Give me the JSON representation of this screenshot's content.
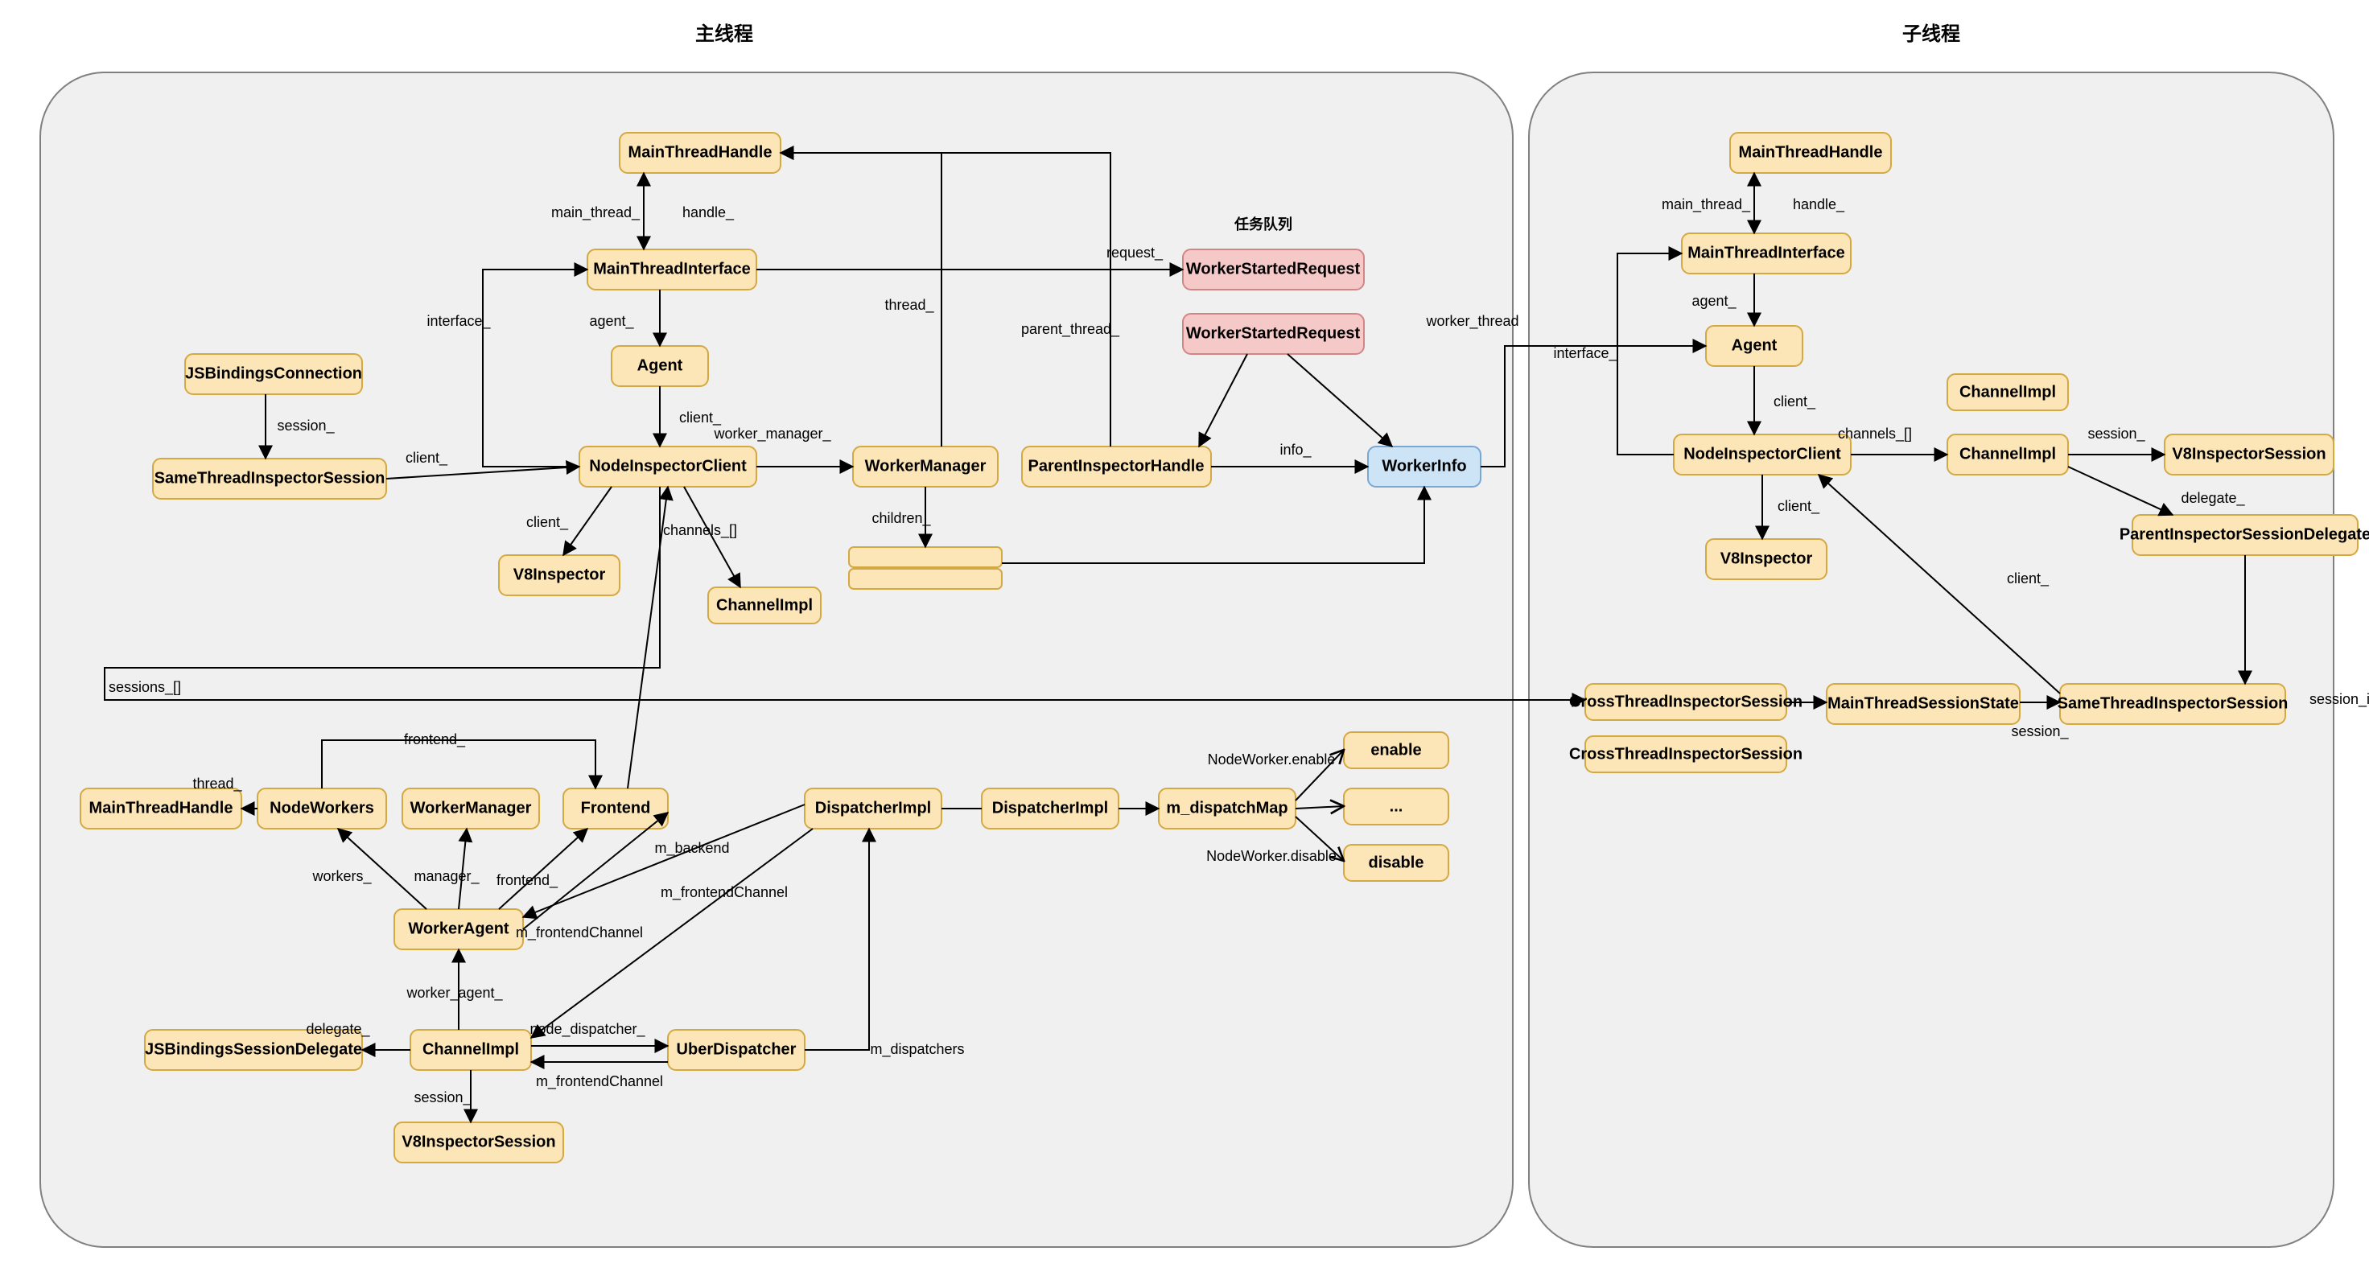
{
  "groups": {
    "left": {
      "title": "主线程"
    },
    "right": {
      "title": "子线程"
    }
  },
  "queueTitle": "任务队列",
  "nodes": {
    "mth_l": "MainThreadHandle",
    "mti_l": "MainThreadInterface",
    "agent_l": "Agent",
    "nic_l": "NodeInspectorClient",
    "v8i_l": "V8Inspector",
    "jsbc": "JSBindingsConnection",
    "stis": "SameThreadInspectorSession",
    "wm": "WorkerManager",
    "children": "",
    "ci_l": "ChannelImpl",
    "pih": "ParentInspectorHandle",
    "wsr1": "WorkerStartedRequest",
    "wsr2": "WorkerStartedRequest",
    "wi": "WorkerInfo",
    "mth_r": "MainThreadHandle",
    "mti_r": "MainThreadInterface",
    "agent_r": "Agent",
    "nic_r": "NodeInspectorClient",
    "v8i_r": "V8Inspector",
    "ci_r1": "ChannelImpl",
    "ci_r2": "ChannelImpl",
    "vis_r": "V8InspectorSession",
    "pisd": "ParentInspectorSessionDelegate",
    "ctis1": "CrossThreadInspectorSession",
    "ctis2": "CrossThreadInspectorSession",
    "mtss": "MainThreadSessionState",
    "stis_r": "SameThreadInspectorSession",
    "mth_b": "MainThreadHandle",
    "nw": "NodeWorkers",
    "wm_b": "WorkerManager",
    "fe": "Frontend",
    "wa": "WorkerAgent",
    "ci_b": "ChannelImpl",
    "jsbsd": "JSBindingsSessionDelegate",
    "vis_b": "V8InspectorSession",
    "ud": "UberDispatcher",
    "di1": "DispatcherImpl",
    "di2": "DispatcherImpl",
    "dm": "m_dispatchMap",
    "enable": "enable",
    "dots": "...",
    "disable": "disable"
  },
  "edges": {
    "main_thread": "main_thread_",
    "handle": "handle_",
    "agent": "agent_",
    "client": "client_",
    "interface": "interface_",
    "session": "session_",
    "worker_manager": "worker_manager_",
    "children": "children_",
    "channels": "channels_[]",
    "thread": "thread_",
    "request": "request_",
    "parent_thread": "parent_thread_",
    "worker_thread": "worker_thread",
    "info": "info_",
    "delegate": "delegate_",
    "session_id": "session_id",
    "sessions": "sessions_[]",
    "frontend": "frontend_",
    "workers": "workers_",
    "manager": "manager_",
    "worker_agent": "worker_agent_",
    "node_dispatcher": "node_dispatcher_",
    "m_dispatchers": "m_dispatchers",
    "m_backend": "m_backend",
    "m_frontendChannel": "m_frontendChannel",
    "nw_enable": "NodeWorker.enable",
    "nw_disable": "NodeWorker.disable"
  }
}
